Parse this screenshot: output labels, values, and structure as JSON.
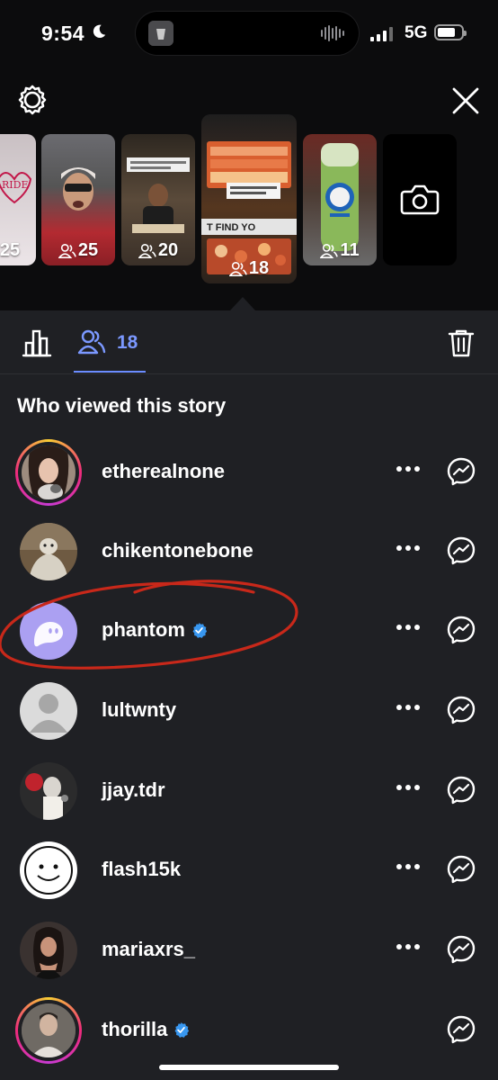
{
  "status_bar": {
    "time": "9:54",
    "network": "5G",
    "battery_level": 0.75
  },
  "stories": [
    {
      "count": "25",
      "selected": false
    },
    {
      "count": "25",
      "selected": false
    },
    {
      "count": "20",
      "selected": false
    },
    {
      "count": "18",
      "selected": true
    },
    {
      "count": "11",
      "selected": false
    }
  ],
  "tabs": {
    "viewers_count": "18"
  },
  "heading": "Who viewed this story",
  "viewers": [
    {
      "username": "etherealnone",
      "verified": false,
      "story_ring": true
    },
    {
      "username": "chikentonebone",
      "verified": false,
      "story_ring": false
    },
    {
      "username": "phantom",
      "verified": true,
      "story_ring": false
    },
    {
      "username": "lultwnty",
      "verified": false,
      "story_ring": false
    },
    {
      "username": "jjay.tdr",
      "verified": false,
      "story_ring": false
    },
    {
      "username": "flash15k",
      "verified": false,
      "story_ring": false
    },
    {
      "username": "mariaxrs_",
      "verified": false,
      "story_ring": false
    },
    {
      "username": "thorilla",
      "verified": true,
      "story_ring": true
    }
  ],
  "colors": {
    "accent": "#7b98ff",
    "verified": "#3897f0",
    "annotation": "#c8281a"
  }
}
